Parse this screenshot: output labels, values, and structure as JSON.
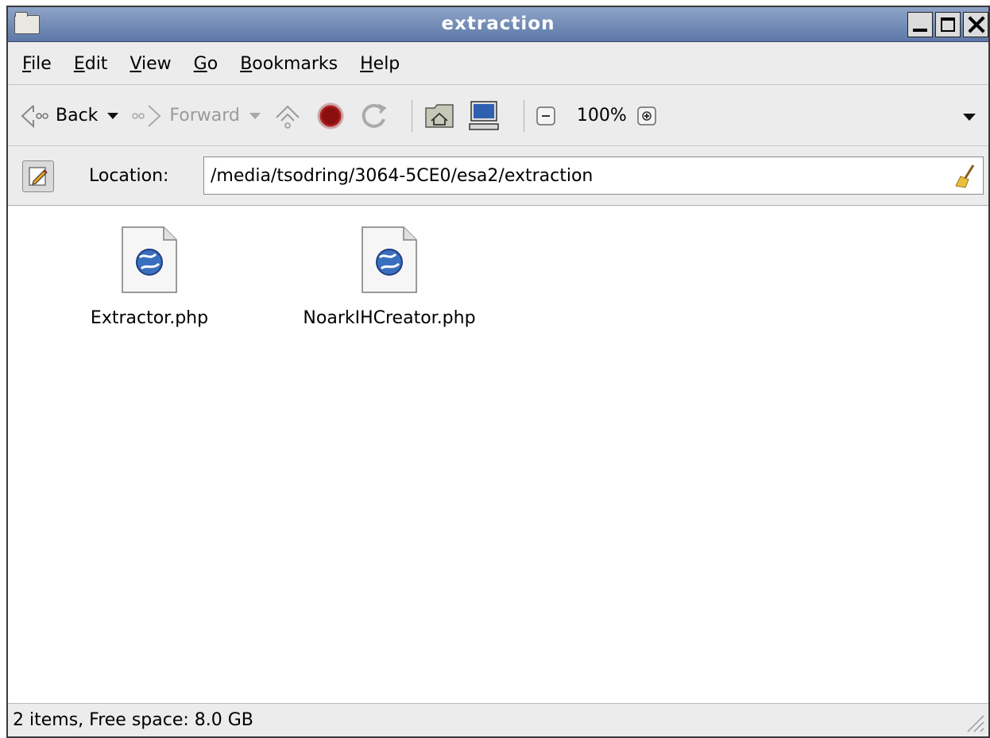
{
  "window": {
    "title": "extraction"
  },
  "menu": {
    "items": [
      {
        "u": "F",
        "rest": "ile"
      },
      {
        "u": "E",
        "rest": "dit"
      },
      {
        "u": "V",
        "rest": "iew"
      },
      {
        "u": "G",
        "rest": "o"
      },
      {
        "u": "B",
        "rest": "ookmarks"
      },
      {
        "u": "H",
        "rest": "elp"
      }
    ]
  },
  "toolbar": {
    "back_label": "Back",
    "forward_label": "Forward",
    "zoom_level": "100%"
  },
  "location": {
    "label": "Location:",
    "value": "/media/tsodring/3064-5CE0/esa2/extraction"
  },
  "files": [
    {
      "name": "Extractor.php",
      "icon": "php-document-icon"
    },
    {
      "name": "NoarkIHCreator.php",
      "icon": "php-document-icon"
    }
  ],
  "status": {
    "text": "2 items, Free space: 8.0 GB"
  },
  "colors": {
    "titlebar": "#6f88b6",
    "chrome": "#ececec"
  }
}
